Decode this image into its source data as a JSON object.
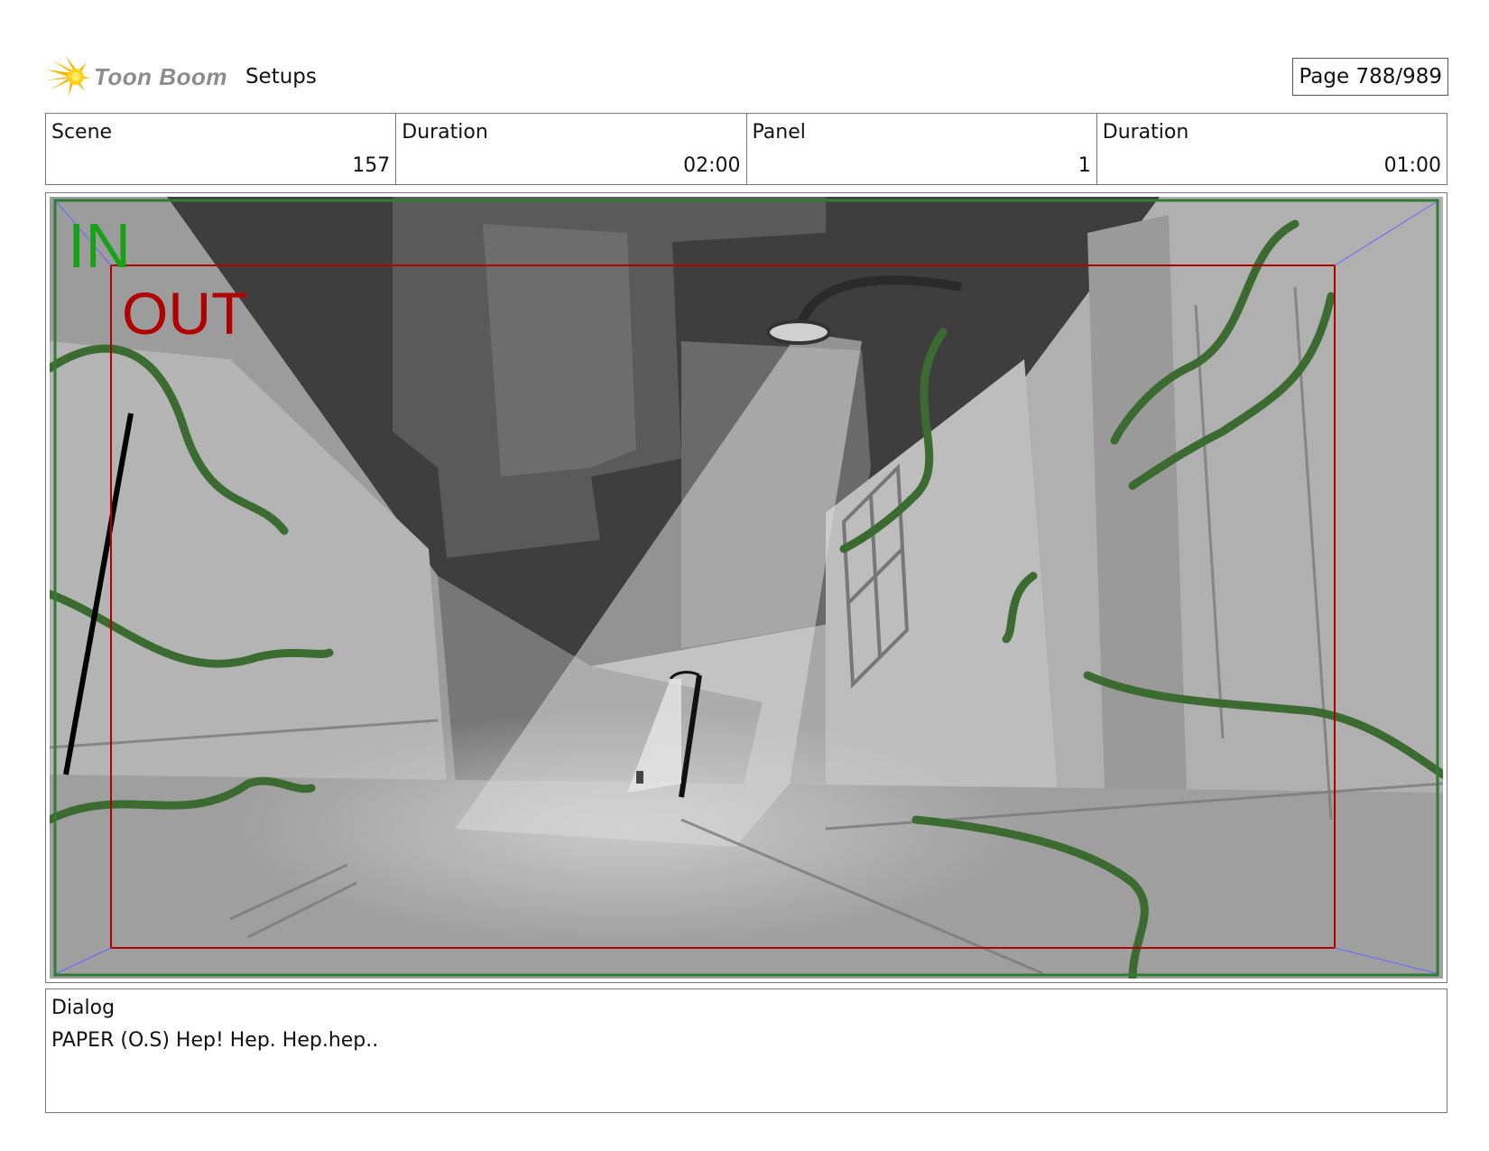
{
  "header": {
    "logo_text": "Toon Boom",
    "section": "Setups",
    "page_label": "Page 788/989"
  },
  "info": [
    {
      "label": "Scene",
      "value": "157"
    },
    {
      "label": "Duration",
      "value": "02:00"
    },
    {
      "label": "Panel",
      "value": "1"
    },
    {
      "label": "Duration",
      "value": "01:00"
    }
  ],
  "panel": {
    "in_label": "IN",
    "out_label": "OUT",
    "in_color": "#1aa11a",
    "out_color": "#b00000",
    "vine_color": "#3c6b32"
  },
  "dialog": {
    "label": "Dialog",
    "text": "PAPER (O.S) Hep! Hep. Hep.hep.."
  }
}
